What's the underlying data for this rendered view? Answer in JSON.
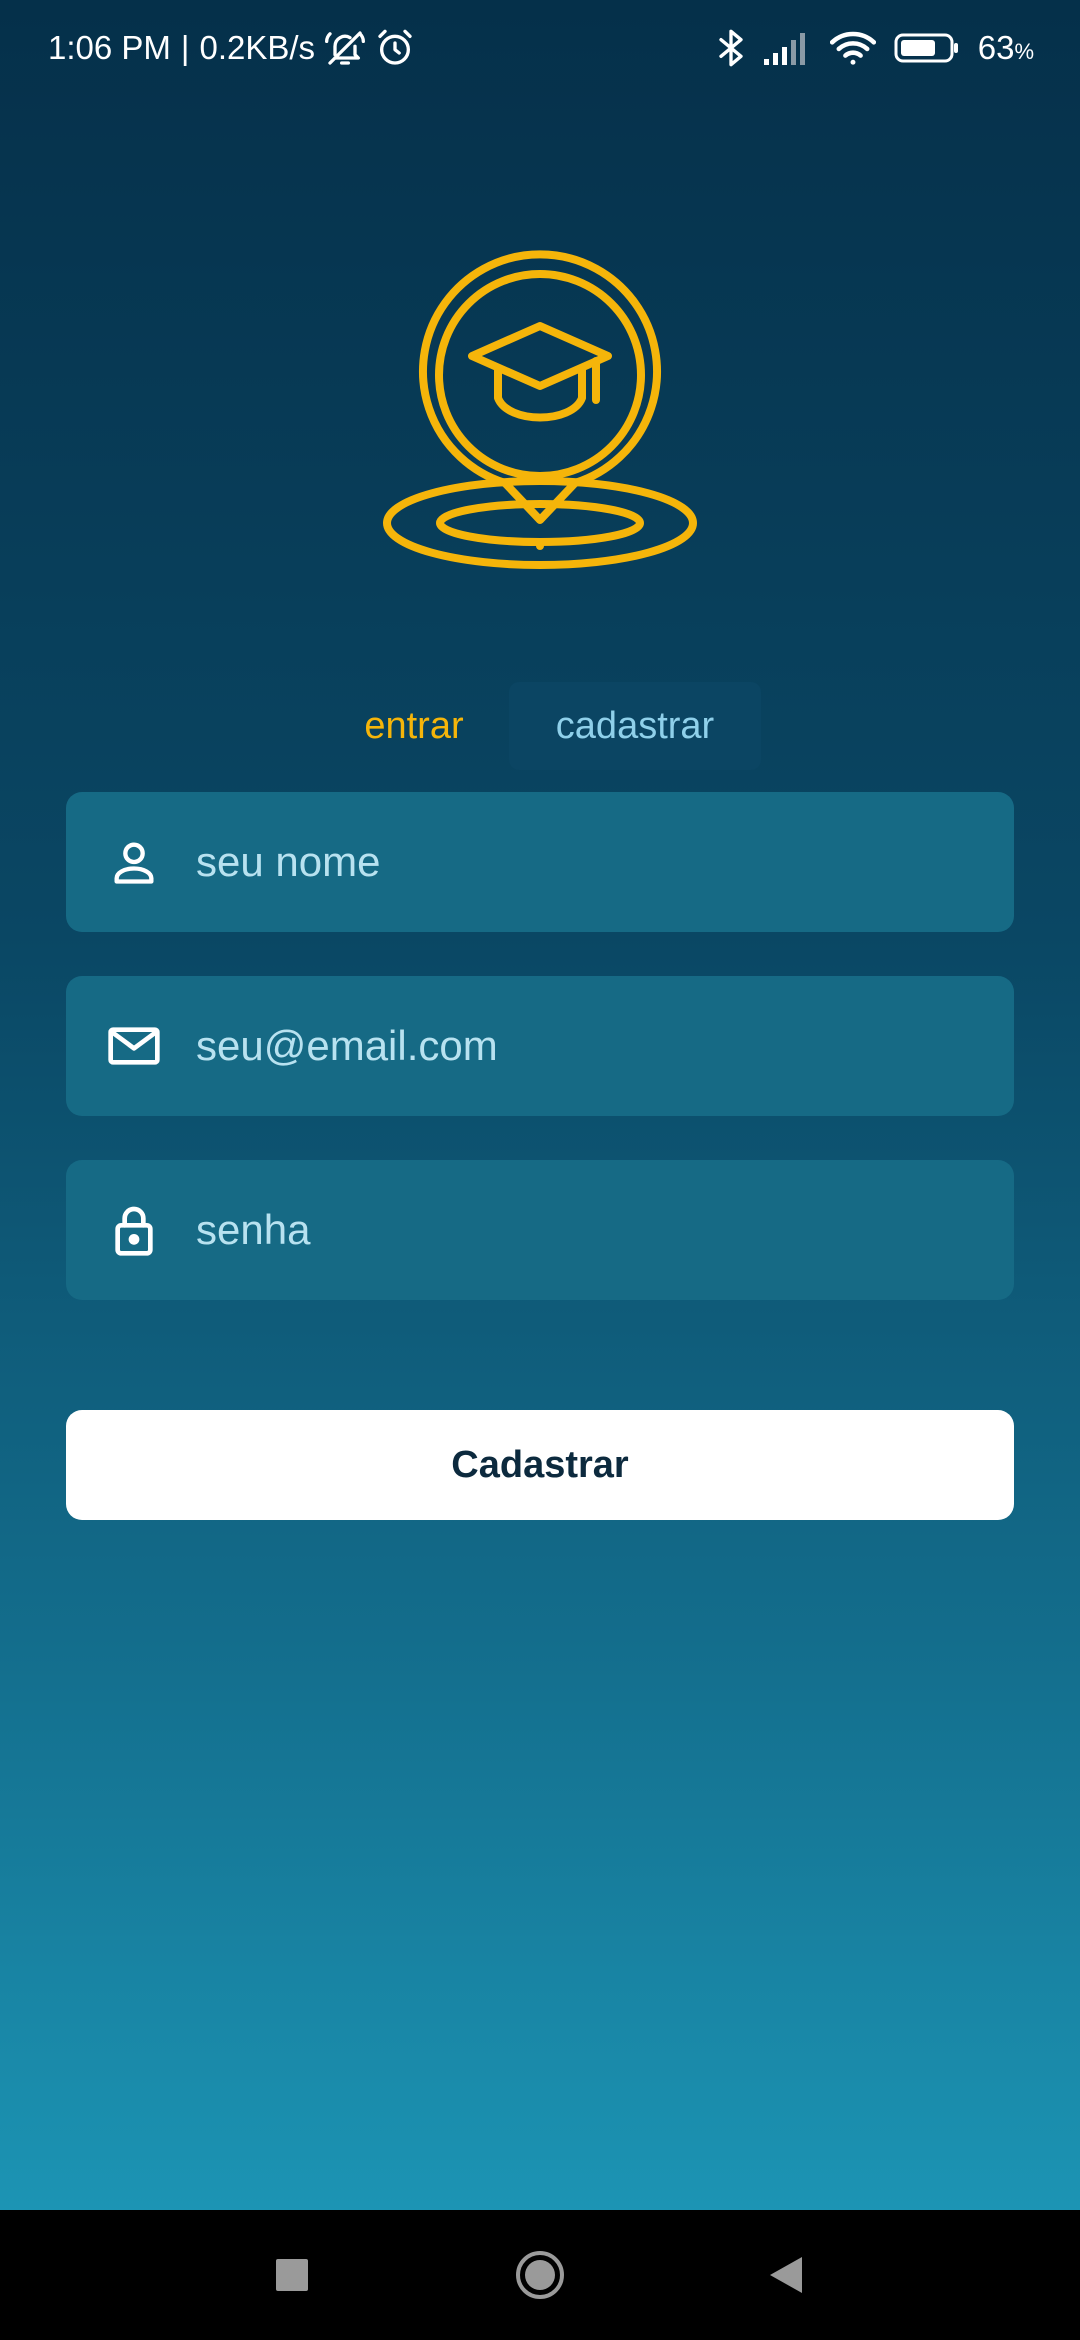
{
  "status_bar": {
    "time": "1:06 PM",
    "separator": "|",
    "net_speed": "0.2KB/s",
    "battery_value": "63",
    "battery_unit": "%",
    "icons_left": [
      "mute-icon",
      "alarm-icon"
    ],
    "icons_right": [
      "bluetooth-icon",
      "signal-icon",
      "wifi-icon",
      "battery-icon"
    ]
  },
  "logo": {
    "icon": "graduation-cap-location-pin-icon",
    "color": "#f5b50a"
  },
  "tabs": [
    {
      "label": "entrar",
      "active": false
    },
    {
      "label": "cadastrar",
      "active": true
    }
  ],
  "form": {
    "name": {
      "icon": "user-icon",
      "value": "",
      "placeholder": "seu nome"
    },
    "email": {
      "icon": "mail-icon",
      "value": "",
      "placeholder": "seu@email.com"
    },
    "password": {
      "icon": "lock-icon",
      "value": "",
      "placeholder": "senha"
    },
    "submit_label": "Cadastrar"
  },
  "nav_bar": {
    "buttons": [
      "recent-apps",
      "home",
      "back"
    ]
  },
  "colors": {
    "accent": "#f5b50a",
    "field_bg": "#166a85",
    "tab_active_bg": "#0b4563",
    "gradient_top": "#05304a",
    "gradient_bottom": "#1e9dbd"
  }
}
